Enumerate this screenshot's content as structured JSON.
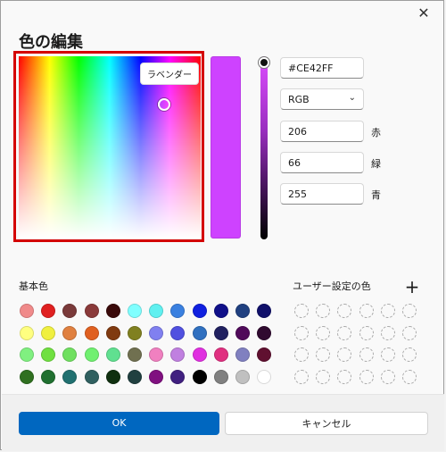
{
  "dialog": {
    "title": "色の編集"
  },
  "picker": {
    "tooltip": "ラベンダー"
  },
  "selected": {
    "color": "#CE42FF"
  },
  "fields": {
    "hex": "#CE42FF",
    "mode": "RGB",
    "channels": [
      {
        "value": "206",
        "label": "赤"
      },
      {
        "value": "66",
        "label": "緑"
      },
      {
        "value": "255",
        "label": "青"
      }
    ]
  },
  "basic": {
    "label": "基本色",
    "colors": [
      [
        "#f08a8a",
        "#e02020",
        "#7a3a3a",
        "#8a3a3a",
        "#3a0a0a",
        "#80ffff",
        "#60f0f0",
        "#3a80e0",
        "#1020e0",
        "#10108a",
        "#204080",
        "#10106a"
      ],
      [
        "#ffff80",
        "#f0f040",
        "#e08040",
        "#e06020",
        "#803a10",
        "#808020",
        "#8080f0",
        "#5050e0",
        "#3070c0",
        "#202060",
        "#500a5a",
        "#300a30"
      ],
      [
        "#80f080",
        "#70e040",
        "#70e060",
        "#70f070",
        "#60e090",
        "#707050",
        "#f080c0",
        "#c080e0",
        "#e030e0",
        "#e03080",
        "#8080c0",
        "#601030"
      ],
      [
        "#307020",
        "#207030",
        "#207070",
        "#306060",
        "#103010",
        "#204040",
        "#801080",
        "#402080",
        "#000000",
        "#808080",
        "#c0c0c0",
        "#ffffff"
      ]
    ]
  },
  "custom": {
    "label": "ユーザー設定の色",
    "add_label": "+"
  },
  "buttons": {
    "ok": "OK",
    "cancel": "キャンセル"
  }
}
